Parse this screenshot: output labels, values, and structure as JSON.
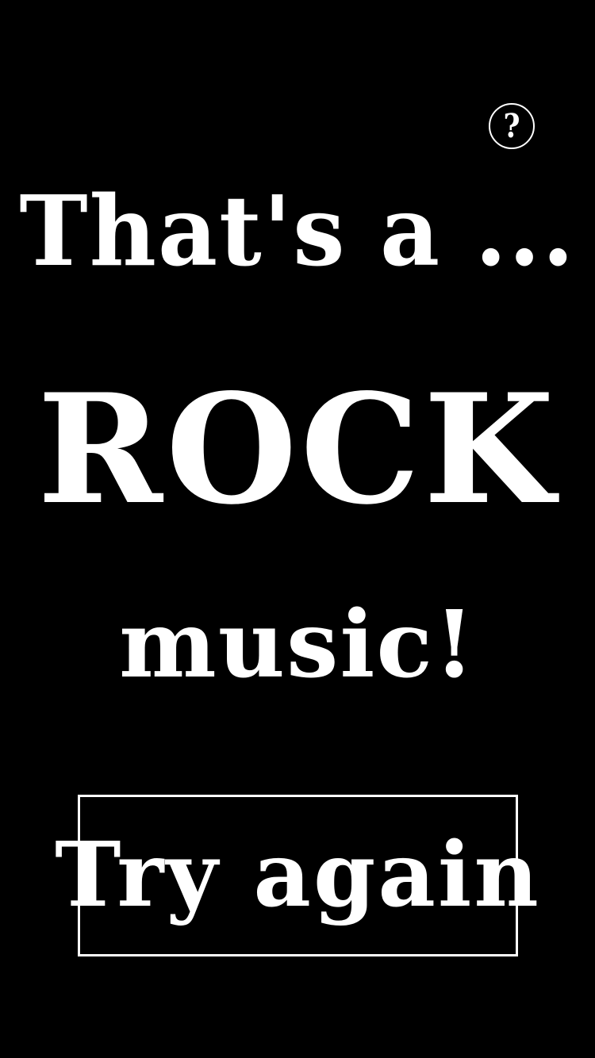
{
  "help": {
    "icon": "question-mark-icon",
    "glyph": "?"
  },
  "result": {
    "intro": "That's a ...",
    "genre": "ROCK",
    "outro": "music!"
  },
  "actions": {
    "try_again_label": "Try again"
  },
  "colors": {
    "background": "#000000",
    "foreground": "#ffffff"
  }
}
